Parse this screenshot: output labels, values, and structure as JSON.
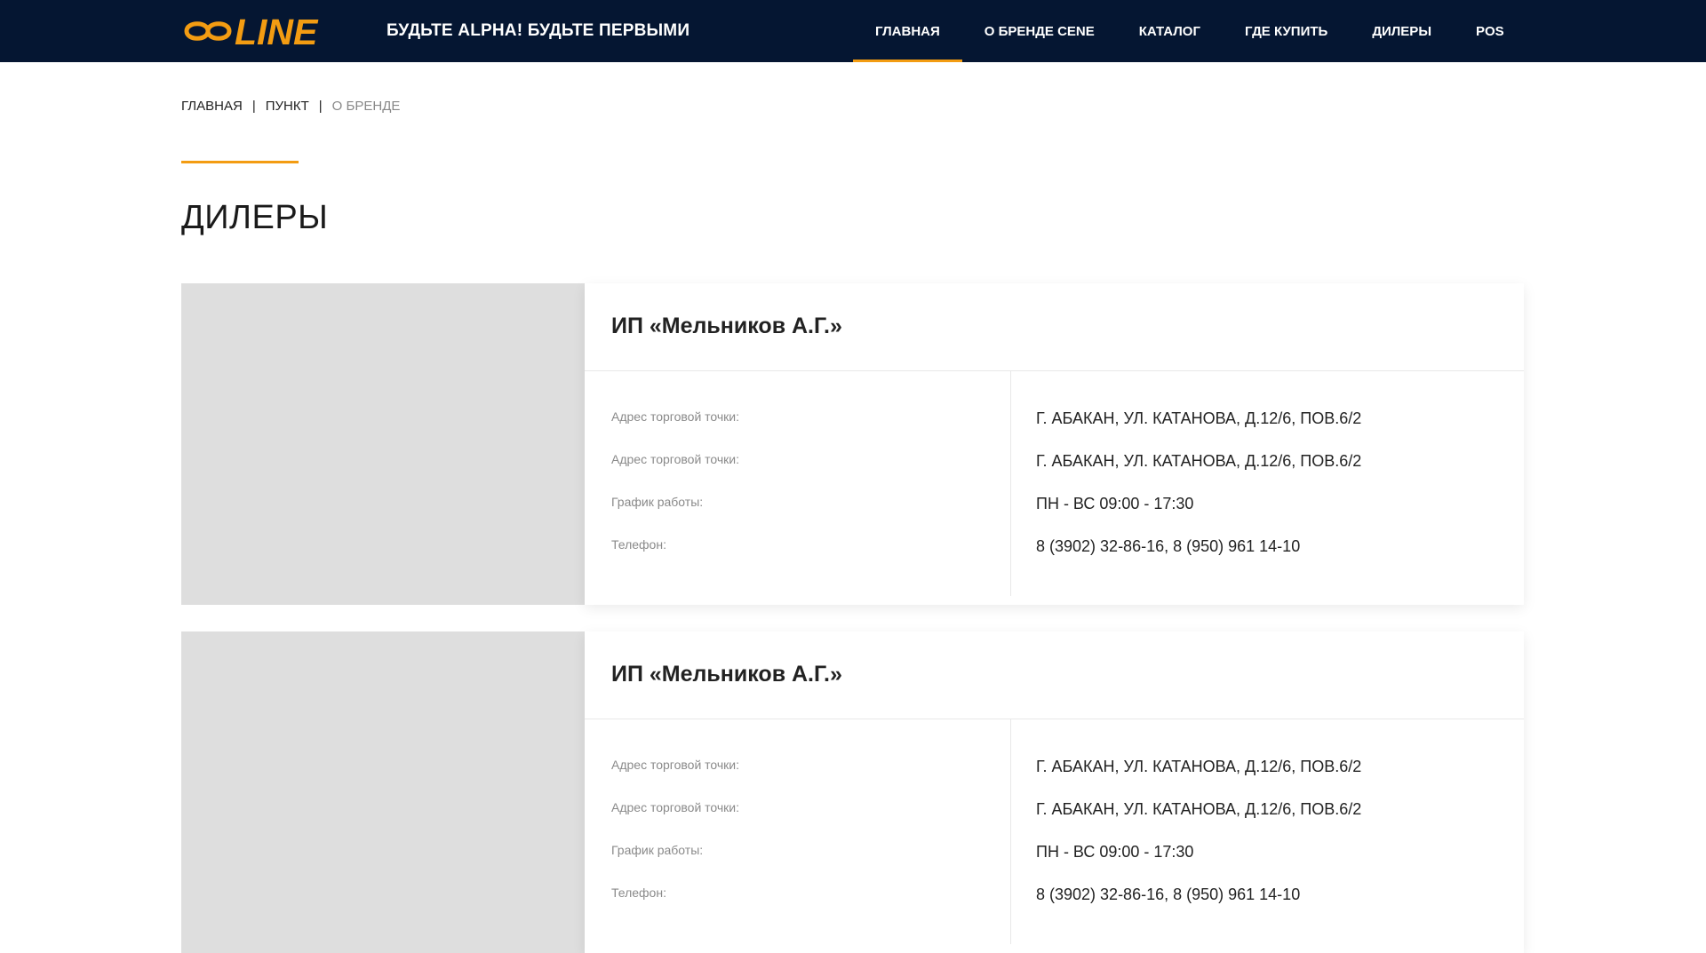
{
  "header": {
    "logo_text": "LINE",
    "tagline": "БУДЬТЕ ALPHA! БУДЬТЕ ПЕРВЫМИ",
    "nav": [
      {
        "label": "ГЛАВНАЯ",
        "active": true
      },
      {
        "label": "О БРЕНДЕ CENE",
        "active": false
      },
      {
        "label": "КАТАЛОГ",
        "active": false
      },
      {
        "label": "ГДЕ КУПИТЬ",
        "active": false
      },
      {
        "label": "ДИЛЕРЫ",
        "active": false
      },
      {
        "label": "POS",
        "active": false
      }
    ]
  },
  "breadcrumb": {
    "items": [
      "ГЛАВНАЯ",
      "ПУНКТ",
      "О БРЕНДЕ"
    ],
    "separator": "|"
  },
  "page": {
    "title": "ДИЛЕРЫ"
  },
  "dealers": [
    {
      "name": "ИП «Мельников А.Г.»",
      "rows": [
        {
          "label": "Адрес торговой точки:",
          "value": "Г. АБАКАН, УЛ. КАТАНОВА, Д.12/6, ПОВ.6/2"
        },
        {
          "label": "Адрес торговой точки:",
          "value": "Г. АБАКАН, УЛ. КАТАНОВА, Д.12/6, ПОВ.6/2"
        },
        {
          "label": "График работы:",
          "value": "ПН - ВС 09:00 - 17:30"
        },
        {
          "label": "Телефон:",
          "value": "8 (3902) 32-86-16, 8 (950) 961 14-10"
        }
      ]
    },
    {
      "name": "ИП «Мельников А.Г.»",
      "rows": [
        {
          "label": "Адрес торговой точки:",
          "value": "Г. АБАКАН, УЛ. КАТАНОВА, Д.12/6, ПОВ.6/2"
        },
        {
          "label": "Адрес торговой точки:",
          "value": "Г. АБАКАН, УЛ. КАТАНОВА, Д.12/6, ПОВ.6/2"
        },
        {
          "label": "График работы:",
          "value": "ПН - ВС 09:00 - 17:30"
        },
        {
          "label": "Телефон:",
          "value": "8 (3902) 32-86-16, 8 (950) 961 14-10"
        }
      ]
    }
  ],
  "colors": {
    "header_bg": "#051632",
    "accent": "#f39c12",
    "photo_placeholder": "#dedede"
  }
}
